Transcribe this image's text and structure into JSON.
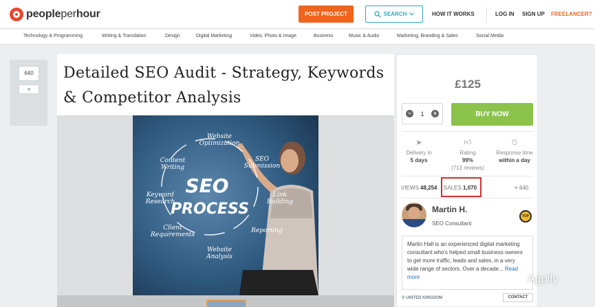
{
  "brand": {
    "name_bold": "people",
    "name_light": "per",
    "name_end": "hour",
    "accent": "#f0641e",
    "logo_color": "#e8482f"
  },
  "header": {
    "post_project": "POST PROJECT",
    "search": "SEARCH",
    "how_it_works": "HOW IT WORKS",
    "login": "LOG IN",
    "signup": "SIGN UP",
    "freelancer": "FREELANCER?"
  },
  "categories": [
    "Technology & Programming",
    "Writing & Translation",
    "Design",
    "Digital Marketing",
    "Video, Photo & Image",
    "Business",
    "Music & Audio",
    "Marketing, Branding & Sales",
    "Social Media"
  ],
  "favorites": {
    "count": "640"
  },
  "offer": {
    "title": "Detailed SEO Audit - Strategy, Keywords & Competitor Analysis",
    "image": {
      "center_line1": "SEO",
      "center_line2": "PROCESS",
      "labels": [
        "Website Optimization",
        "SEO Submission",
        "Link Building",
        "Reporting",
        "Website Analysis",
        "Client Requirements",
        "Keyword Research",
        "Content Writing"
      ]
    }
  },
  "purchase": {
    "price": "£125",
    "quantity": "1",
    "buy_now": "BUY NOW",
    "buy_color": "#8bc34a"
  },
  "stats": {
    "delivery_label": "Delivery in",
    "delivery_value": "5 days",
    "rating_label": "Rating",
    "rating_value": "99%",
    "rating_reviews": "(713 reviews)",
    "response_label": "Response time",
    "response_value": "within a day"
  },
  "counts": {
    "views_label": "VIEWS",
    "views_value": "48,254",
    "sales_label": "SALES",
    "sales_value": "1,070",
    "hearts_value": "640"
  },
  "seller": {
    "name": "Martin H.",
    "role": "SEO Consultant",
    "badge": "TOP",
    "bio": "Martin Hall is an experienced digital marketing consultant who's helped small business owners to get more traffic, leads and sales, in a very wide range of sectors. Over a decade...",
    "read_more": "Read more",
    "location": "UNITED KINGDOM",
    "contact": "CONTACT"
  },
  "watermark": {
    "text": "Appify"
  }
}
